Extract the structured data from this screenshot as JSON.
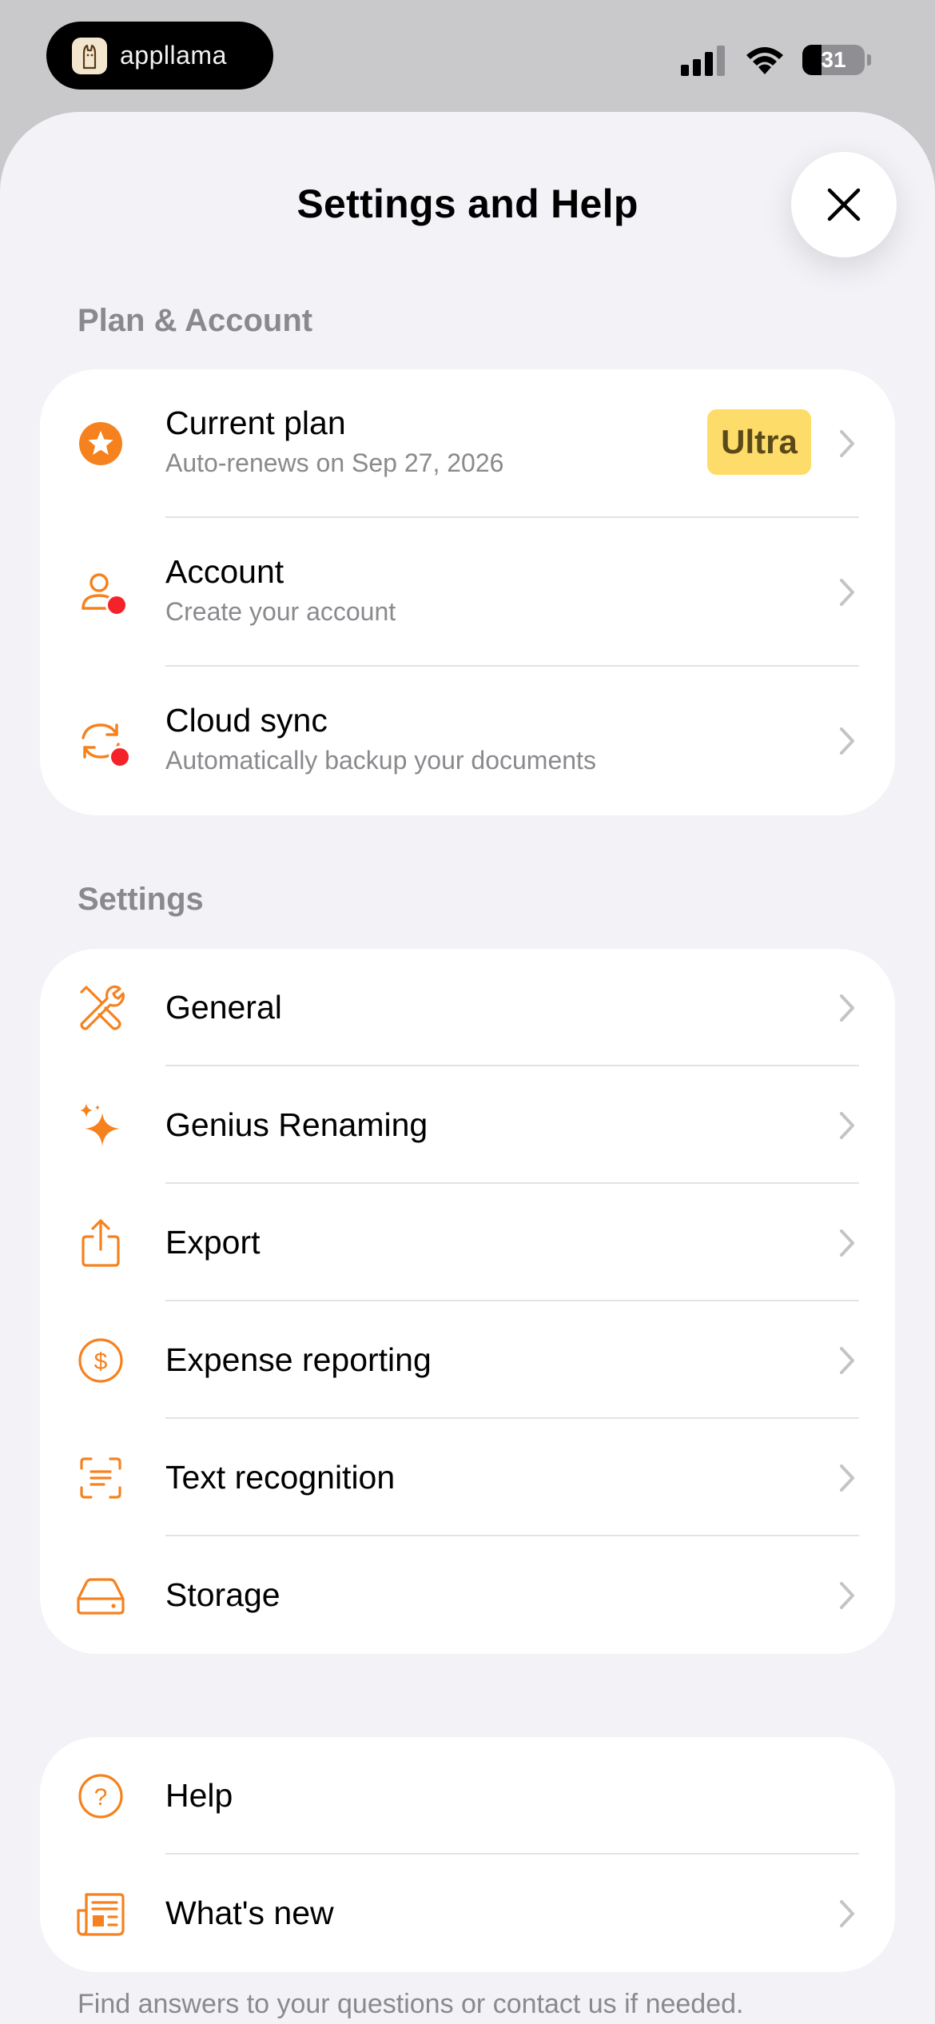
{
  "status_bar": {
    "app_name": "appllama",
    "battery_level": "31"
  },
  "sheet": {
    "title": "Settings and Help"
  },
  "plan_section": {
    "header": "Plan & Account",
    "items": [
      {
        "title": "Current plan",
        "subtitle": "Auto-renews on Sep 27, 2026",
        "badge": "Ultra",
        "icon": "star-circle-icon"
      },
      {
        "title": "Account",
        "subtitle": "Create your account",
        "icon": "person-icon"
      },
      {
        "title": "Cloud sync",
        "subtitle": "Automatically backup your documents",
        "icon": "sync-icon"
      }
    ]
  },
  "settings_section": {
    "header": "Settings",
    "items": [
      {
        "title": "General",
        "icon": "tools-icon"
      },
      {
        "title": "Genius Renaming",
        "icon": "sparkle-icon"
      },
      {
        "title": "Export",
        "icon": "share-icon"
      },
      {
        "title": "Expense reporting",
        "icon": "dollar-circle-icon"
      },
      {
        "title": "Text recognition",
        "icon": "text-scan-icon"
      },
      {
        "title": "Storage",
        "icon": "drive-icon"
      }
    ]
  },
  "help_section": {
    "items": [
      {
        "title": "Help",
        "icon": "question-circle-icon"
      },
      {
        "title": "What's new",
        "icon": "newspaper-icon"
      }
    ],
    "footer": "Find answers to your questions or contact us if needed."
  },
  "colors": {
    "accent": "#f5821f",
    "badge": "#fedc6a",
    "notification": "#f4232a",
    "sheet_bg": "#f2f2f7",
    "secondary_text": "#8a8a8e"
  }
}
